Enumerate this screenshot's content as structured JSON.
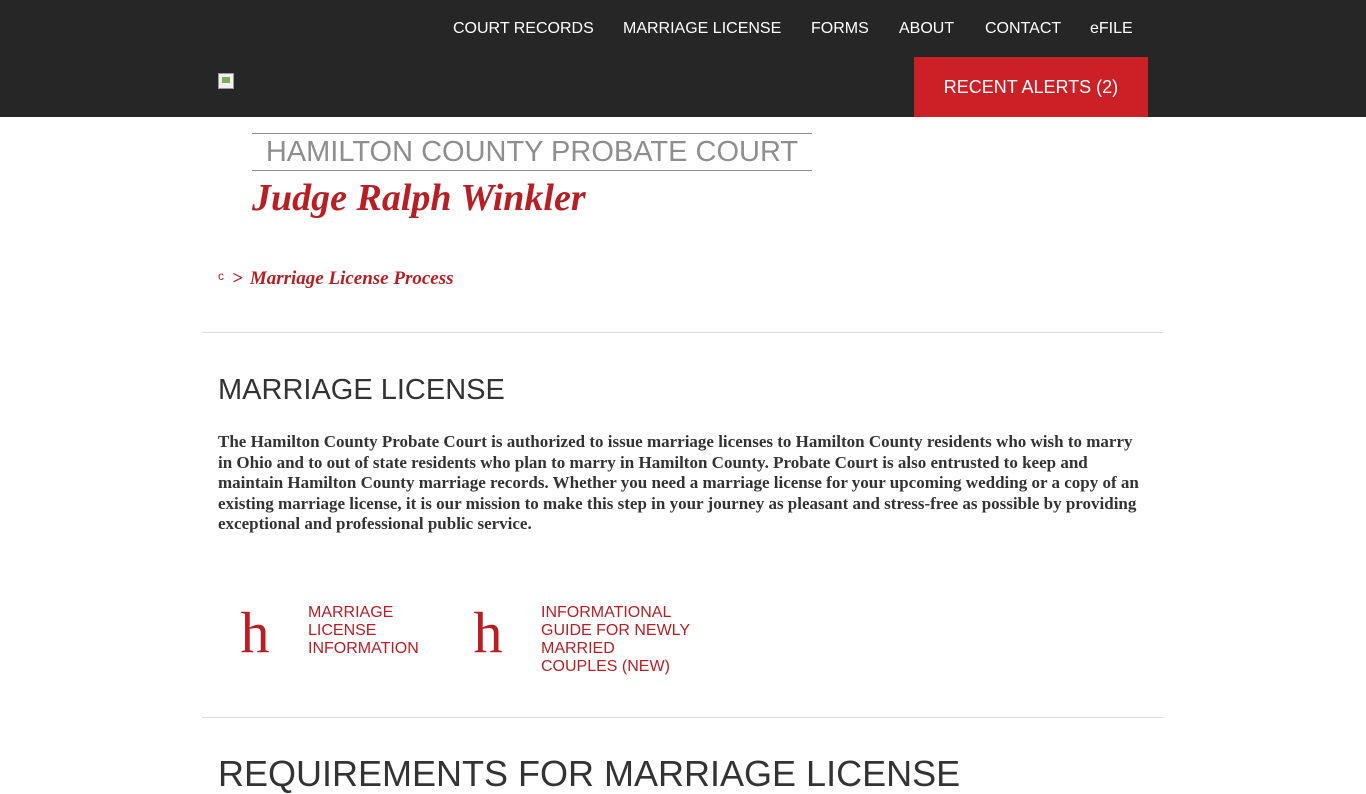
{
  "header": {
    "nav": [
      {
        "label": "COURT RECORDS"
      },
      {
        "label": "MARRIAGE LICENSE"
      },
      {
        "label": "FORMS"
      },
      {
        "label": "ABOUT"
      },
      {
        "label": "CONTACT"
      },
      {
        "label": "eFILE"
      }
    ],
    "alerts_label": "RECENT ALERTS (2)",
    "logo_icon": "broken-image-icon"
  },
  "court": {
    "name": "HAMILTON COUNTY PROBATE COURT",
    "judge": "Judge Ralph Winkler"
  },
  "breadcrumb": {
    "home_icon_glyph": "c",
    "separator": ">",
    "current": "Marriage License Process"
  },
  "main": {
    "title": "MARRIAGE LICENSE",
    "intro": "The Hamilton County Probate Court is authorized to issue marriage licenses to Hamilton County residents who wish to marry in Ohio and to out of state residents who plan to marry in Hamilton County.  Probate Court is also entrusted to keep and maintain Hamilton County marriage records.  Whether you need a marriage license for your upcoming wedding or a copy of an existing marriage license, it is our mission to make this step in your journey as pleasant and stress-free as possible by providing exceptional and professional public service.",
    "links": [
      {
        "icon_glyph": "h",
        "label": "MARRIAGE LICENSE INFORMATION"
      },
      {
        "icon_glyph": "h",
        "label": "INFORMATIONAL GUIDE FOR NEWLY MARRIED COUPLES (NEW)"
      }
    ],
    "next_section_title": "REQUIREMENTS FOR MARRIAGE LICENSE"
  },
  "colors": {
    "header_bg": "#262626",
    "accent_red": "#cc2027",
    "text_red": "#b71f24",
    "court_gray": "#8e8e8e"
  }
}
